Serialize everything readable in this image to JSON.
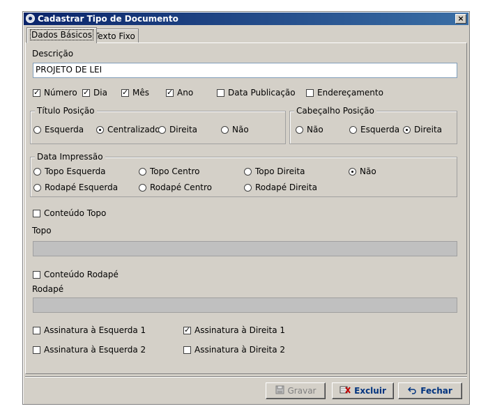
{
  "window": {
    "title": "Cadastrar Tipo de Documento",
    "close_label": "×"
  },
  "tabs": [
    {
      "label": "Dados Básicos",
      "active": true
    },
    {
      "label": "Texto Fixo",
      "active": false
    }
  ],
  "descricao": {
    "label": "Descrição",
    "value": "PROJETO DE LEI"
  },
  "options": {
    "numero": {
      "label": "Número",
      "checked": true
    },
    "dia": {
      "label": "Dia",
      "checked": true
    },
    "mes": {
      "label": "Mês",
      "checked": true
    },
    "ano": {
      "label": "Ano",
      "checked": true
    },
    "data_publicacao": {
      "label": "Data Publicação",
      "checked": false
    },
    "enderecamento": {
      "label": "Endereçamento",
      "checked": false
    }
  },
  "titulo_posicao": {
    "legend": "Título Posição",
    "options": [
      "Esquerda",
      "Centralizado",
      "Direita",
      "Não"
    ],
    "selected": "Centralizado"
  },
  "cabecalho_posicao": {
    "legend": "Cabeçalho Posição",
    "options": [
      "Não",
      "Esquerda",
      "Direita"
    ],
    "selected": "Direita"
  },
  "data_impressao": {
    "legend": "Data Impressão",
    "row1": [
      "Topo Esquerda",
      "Topo Centro",
      "Topo Direita",
      "Não"
    ],
    "row2": [
      "Rodapé Esquerda",
      "Rodapé Centro",
      "Rodapé Direita"
    ],
    "selected": "Não"
  },
  "conteudo_topo": {
    "checkbox_label": "Conteúdo Topo",
    "checked": false,
    "field_label": "Topo",
    "value": ""
  },
  "conteudo_rodape": {
    "checkbox_label": "Conteúdo Rodapé",
    "checked": false,
    "field_label": "Rodapé",
    "value": ""
  },
  "assinaturas": {
    "esq1": {
      "label": "Assinatura à Esquerda 1",
      "checked": false
    },
    "dir1": {
      "label": "Assinatura à Direita 1",
      "checked": true
    },
    "esq2": {
      "label": "Assinatura à Esquerda 2",
      "checked": false
    },
    "dir2": {
      "label": "Assinatura à Direita 2",
      "checked": false
    }
  },
  "buttons": {
    "gravar": {
      "label": "Gravar",
      "icon": "save-icon",
      "enabled": false
    },
    "excluir": {
      "label": "Excluir",
      "icon": "delete-icon",
      "enabled": true
    },
    "fechar": {
      "label": "Fechar",
      "icon": "undo-icon",
      "enabled": true
    }
  }
}
